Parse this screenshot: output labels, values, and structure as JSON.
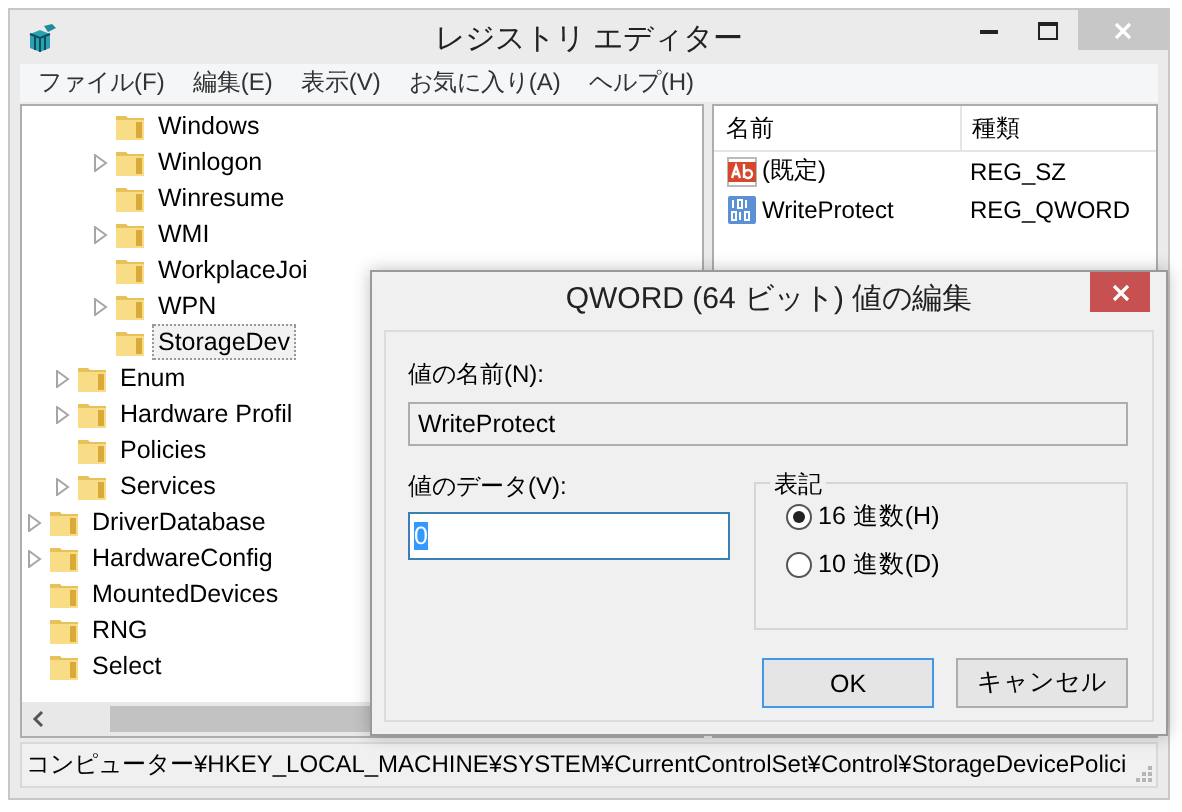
{
  "window": {
    "title": "レジストリ エディター"
  },
  "menu": [
    "ファイル(F)",
    "編集(E)",
    "表示(V)",
    "お気に入り(A)",
    "ヘルプ(H)"
  ],
  "tree": [
    {
      "children": [
        {
          "children": [
            {
              "label": "Windows",
              "expandable": false,
              "selected": false
            },
            {
              "label": "Winlogon",
              "expandable": true,
              "selected": false
            },
            {
              "label": "Winresume",
              "expandable": false,
              "selected": false
            },
            {
              "label": "WMI",
              "expandable": true,
              "selected": false
            },
            {
              "label": "WorkplaceJoi",
              "expandable": false,
              "selected": false
            },
            {
              "label": "WPN",
              "expandable": true,
              "selected": false
            },
            {
              "label": "StorageDev",
              "expandable": false,
              "selected": true
            }
          ]
        },
        {
          "label": "Enum",
          "expandable": true,
          "selected": false
        },
        {
          "label": "Hardware Profil",
          "expandable": true,
          "selected": false
        },
        {
          "label": "Policies",
          "expandable": false,
          "selected": false
        },
        {
          "label": "Services",
          "expandable": true,
          "selected": false
        }
      ]
    },
    {
      "label": "DriverDatabase",
      "expandable": true,
      "selected": false
    },
    {
      "label": "HardwareConfig",
      "expandable": true,
      "selected": false
    },
    {
      "label": "MountedDevices",
      "expandable": false,
      "selected": false
    },
    {
      "label": "RNG",
      "expandable": false,
      "selected": false
    },
    {
      "label": "Select",
      "expandable": false,
      "selected": false
    }
  ],
  "values": {
    "columns": [
      "名前",
      "種類"
    ],
    "rows": [
      {
        "kind": "string",
        "name": "(既定)",
        "type": "REG_SZ"
      },
      {
        "kind": "binary",
        "name": "WriteProtect",
        "type": "REG_QWORD"
      }
    ]
  },
  "status_bar": "コンピューター¥HKEY_LOCAL_MACHINE¥SYSTEM¥CurrentControlSet¥Control¥StorageDevicePolici",
  "dialog": {
    "title": "QWORD (64 ビット) 値の編集",
    "name_label": "値の名前(N):",
    "name_value": "WriteProtect",
    "data_label": "値のデータ(V):",
    "data_value": "0",
    "base_group": "表記",
    "bases": [
      {
        "label": "16 進数(H)",
        "selected": true
      },
      {
        "label": "10 進数(D)",
        "selected": false
      }
    ],
    "buttons": [
      {
        "label": "OK",
        "default": true
      },
      {
        "label": "キャンセル",
        "default": false
      }
    ]
  }
}
